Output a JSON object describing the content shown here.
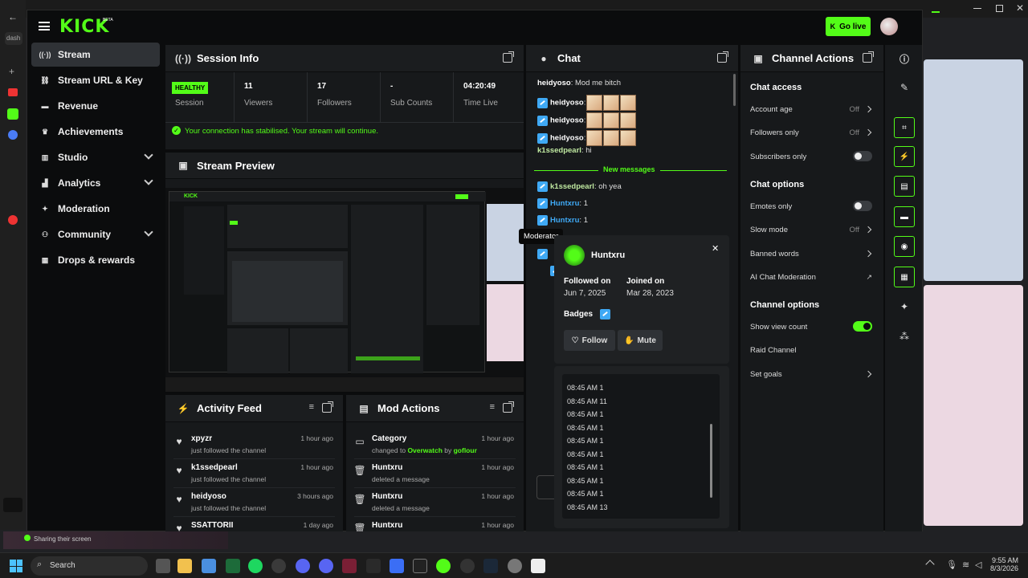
{
  "host": {
    "side_label": "dash",
    "sharing": "Sharing their screen"
  },
  "topbar": {
    "logo": "KICK",
    "logo_beta": "BETA",
    "go_live": "Go live"
  },
  "sidebar": {
    "items": [
      {
        "label": "Stream",
        "icon": "stream-icon",
        "active": true
      },
      {
        "label": "Stream URL & Key",
        "icon": "link-icon"
      },
      {
        "label": "Revenue",
        "icon": "money-icon"
      },
      {
        "label": "Achievements",
        "icon": "trophy-icon"
      },
      {
        "label": "Studio",
        "icon": "studio-icon",
        "chevron": true
      },
      {
        "label": "Analytics",
        "icon": "chart-icon",
        "chevron": true
      },
      {
        "label": "Moderation",
        "icon": "wrench-icon"
      },
      {
        "label": "Community",
        "icon": "community-icon",
        "chevron": true
      },
      {
        "label": "Drops & rewards",
        "icon": "gift-icon"
      }
    ]
  },
  "session": {
    "title": "Session Info",
    "health": "HEALTHY",
    "health_label": "Session",
    "stats": [
      {
        "value": "11",
        "label": "Viewers"
      },
      {
        "value": "17",
        "label": "Followers"
      },
      {
        "value": "-",
        "label": "Sub Counts"
      },
      {
        "value": "04:20:49",
        "label": "Time Live"
      }
    ],
    "notice": "Your connection has stabilised. Your stream will continue."
  },
  "preview": {
    "title": "Stream Preview"
  },
  "activity": {
    "title": "Activity Feed",
    "items": [
      {
        "name": "xpyzr",
        "desc": "just followed the channel",
        "time": "1 hour ago"
      },
      {
        "name": "k1ssedpearl",
        "desc": "just followed the channel",
        "time": "1 hour ago"
      },
      {
        "name": "heidyoso",
        "desc": "just followed the channel",
        "time": "3 hours ago"
      },
      {
        "name": "SSATTORII",
        "desc": "",
        "time": "1 day ago"
      }
    ]
  },
  "modactions": {
    "title": "Mod Actions",
    "items": [
      {
        "name": "Category",
        "desc_pre": "changed to ",
        "game": "Overwatch",
        "desc_mid": " by ",
        "user": "goflour",
        "time": "1 hour ago"
      },
      {
        "name": "Huntxru",
        "desc": "deleted a message",
        "time": "1 hour ago"
      },
      {
        "name": "Huntxru",
        "desc": "deleted a message",
        "time": "1 hour ago"
      },
      {
        "name": "Huntxru",
        "desc": "",
        "time": "1 hour ago"
      }
    ]
  },
  "chat": {
    "title": "Chat",
    "messages": [
      {
        "user": "heidyoso",
        "text": " Mod me bitch"
      },
      {
        "user": "heidyoso",
        "emotes": 3
      },
      {
        "user": "heidyoso",
        "emotes": 3
      },
      {
        "user": "heidyoso",
        "emotes": 3
      },
      {
        "user": "k1ssedpearl",
        "text": " hi"
      }
    ],
    "divider": "New messages",
    "after": [
      {
        "user": "k1ssedpearl",
        "text": " oh yea"
      },
      {
        "user": "Huntxru",
        "text": " 1"
      },
      {
        "user": "Huntxru",
        "text": " 1"
      }
    ]
  },
  "tooltip": "Moderator",
  "usercard": {
    "name": "Huntxru",
    "followed_label": "Followed on",
    "followed": "Jun 7, 2025",
    "joined_label": "Joined on",
    "joined": "Mar 28, 2023",
    "badges": "Badges",
    "follow": "Follow",
    "mute": "Mute",
    "log": [
      "08:45 AM 1",
      "08:45 AM 11",
      "08:45 AM 1",
      "08:45 AM 1",
      "08:45 AM 1",
      "08:45 AM 1",
      "08:45 AM 1",
      "08:45 AM 1",
      "08:45 AM 1",
      "08:45 AM 13"
    ]
  },
  "actions": {
    "title": "Channel Actions",
    "chat_access": "Chat access",
    "account_age": "Account age",
    "followers_only": "Followers only",
    "off": "Off",
    "subscribers_only": "Subscribers only",
    "chat_options": "Chat options",
    "emotes_only": "Emotes only",
    "slow_mode": "Slow mode",
    "banned_words": "Banned words",
    "ai_mod": "AI Chat Moderation",
    "channel_options": "Channel options",
    "show_view_count": "Show view count",
    "raid": "Raid Channel",
    "set_goals": "Set goals"
  },
  "taskbar": {
    "search": "Search",
    "time": "9:55 AM",
    "date": "8/3/2026"
  },
  "colors": {
    "accent": "#53fc18",
    "badge": "#3fa9f5"
  }
}
